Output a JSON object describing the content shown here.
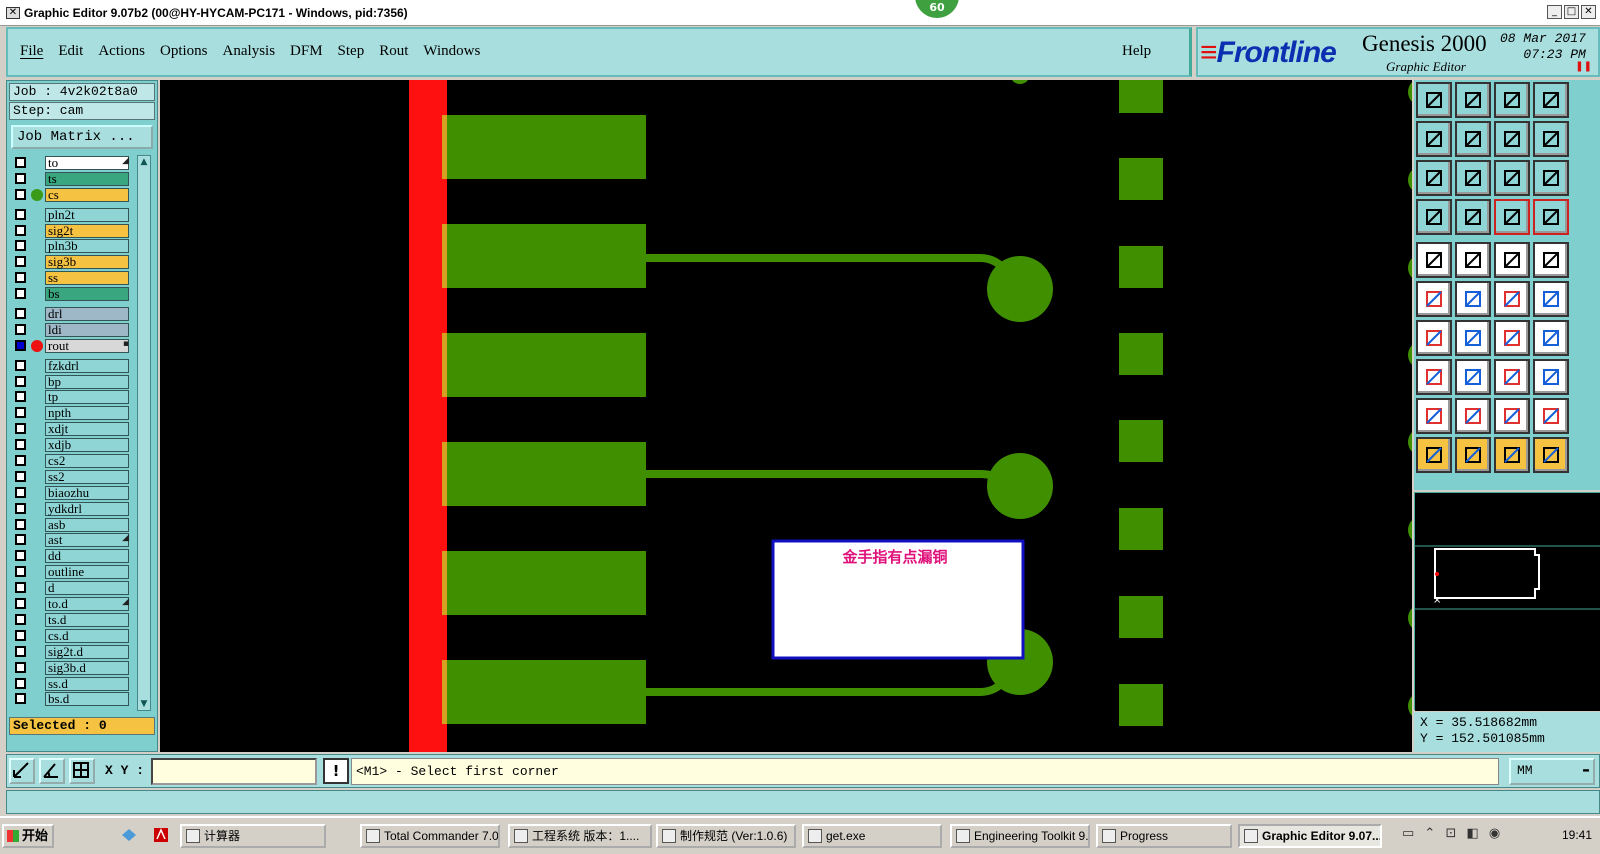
{
  "window": {
    "title": "Graphic Editor 9.07b2 (00@HY-HYCAM-PC171 - Windows, pid:7356)",
    "fps_badge": "60"
  },
  "menu": {
    "items": [
      "File",
      "Edit",
      "Actions",
      "Options",
      "Analysis",
      "DFM",
      "Step",
      "Rout",
      "Windows"
    ],
    "help": "Help"
  },
  "brand": {
    "logo": "Frontline",
    "product": "Genesis 2000",
    "subtitle": "Graphic Editor",
    "date": "08 Mar 2017",
    "time": "07:23 PM"
  },
  "job": {
    "job_label": "Job : 4v2k02t8a0",
    "step_label": "Step: cam",
    "matrix_button": "Job Matrix ..."
  },
  "layers": [
    {
      "name": "to",
      "color": "#ffffff",
      "mark": "◢"
    },
    {
      "name": "ts",
      "color": "#3aa680"
    },
    {
      "name": "cs",
      "color": "#f5c242",
      "dot": "#3a9a1a"
    },
    {
      "name": "pln2t",
      "color": "#8fd5d5"
    },
    {
      "name": "sig2t",
      "color": "#f5c242"
    },
    {
      "name": "pln3b",
      "color": "#8fd5d5"
    },
    {
      "name": "sig3b",
      "color": "#f5c242"
    },
    {
      "name": "ss",
      "color": "#f5c242"
    },
    {
      "name": "bs",
      "color": "#3aa680"
    },
    {
      "name": "drl",
      "color": "#9fb8c8"
    },
    {
      "name": "ldi",
      "color": "#9fb8c8"
    },
    {
      "name": "rout",
      "color": "#d8d8d8",
      "dot": "#ee1111",
      "checked": true,
      "mark": "▪"
    },
    {
      "name": "fzkdrl",
      "color": "#8fd5d5"
    },
    {
      "name": "bp",
      "color": "#8fd5d5"
    },
    {
      "name": "tp",
      "color": "#8fd5d5"
    },
    {
      "name": "npth",
      "color": "#8fd5d5"
    },
    {
      "name": "xdjt",
      "color": "#8fd5d5"
    },
    {
      "name": "xdjb",
      "color": "#8fd5d5"
    },
    {
      "name": "cs2",
      "color": "#8fd5d5"
    },
    {
      "name": "ss2",
      "color": "#8fd5d5"
    },
    {
      "name": "biaozhu",
      "color": "#8fd5d5"
    },
    {
      "name": "ydkdrl",
      "color": "#8fd5d5"
    },
    {
      "name": "asb",
      "color": "#8fd5d5"
    },
    {
      "name": "ast",
      "color": "#8fd5d5",
      "mark": "◢"
    },
    {
      "name": "dd",
      "color": "#8fd5d5"
    },
    {
      "name": "outline",
      "color": "#8fd5d5"
    },
    {
      "name": "d",
      "color": "#8fd5d5"
    },
    {
      "name": "to.d",
      "color": "#8fd5d5",
      "mark": "◢"
    },
    {
      "name": "ts.d",
      "color": "#8fd5d5"
    },
    {
      "name": "cs.d",
      "color": "#8fd5d5"
    },
    {
      "name": "sig2t.d",
      "color": "#8fd5d5"
    },
    {
      "name": "sig3b.d",
      "color": "#8fd5d5"
    },
    {
      "name": "ss.d",
      "color": "#8fd5d5"
    },
    {
      "name": "bs.d",
      "color": "#8fd5d5"
    }
  ],
  "selected_label": "Selected : 0",
  "canvas": {
    "annotation_text": "金手指有点漏铜",
    "colors": {
      "background": "#000000",
      "copper": "#3f8f00",
      "rout": "#ff1010",
      "gold_edge": "#d8a020",
      "note_border": "#1010c0",
      "note_text": "#e0107a"
    }
  },
  "coords": {
    "x": "X = 35.518682mm",
    "y": "Y = 152.501085mm"
  },
  "command": {
    "xy_label": "X Y :",
    "xy_value": "",
    "bang": "!",
    "prompt": "<M1> - Select first corner",
    "units": "MM"
  },
  "taskbar": {
    "start": "开始",
    "tasks": [
      {
        "label": "计算器",
        "icon": "calculator-icon"
      },
      {
        "label": "Total Commander 7.0 ...",
        "icon": "floppy-icon"
      },
      {
        "label": "工程系统  版本：1....",
        "icon": "p-app-icon"
      },
      {
        "label": "制作规范 (Ver:1.0.6)",
        "icon": "document-icon"
      },
      {
        "label": "get.exe",
        "icon": "gear-icon"
      },
      {
        "label": "Engineering Toolkit 9....",
        "icon": "x-app-icon"
      },
      {
        "label": "Progress",
        "icon": "x-app-icon"
      },
      {
        "label": "Graphic Editor 9.07...",
        "icon": "x-app-icon",
        "active": true
      }
    ],
    "clock": "19:41"
  }
}
